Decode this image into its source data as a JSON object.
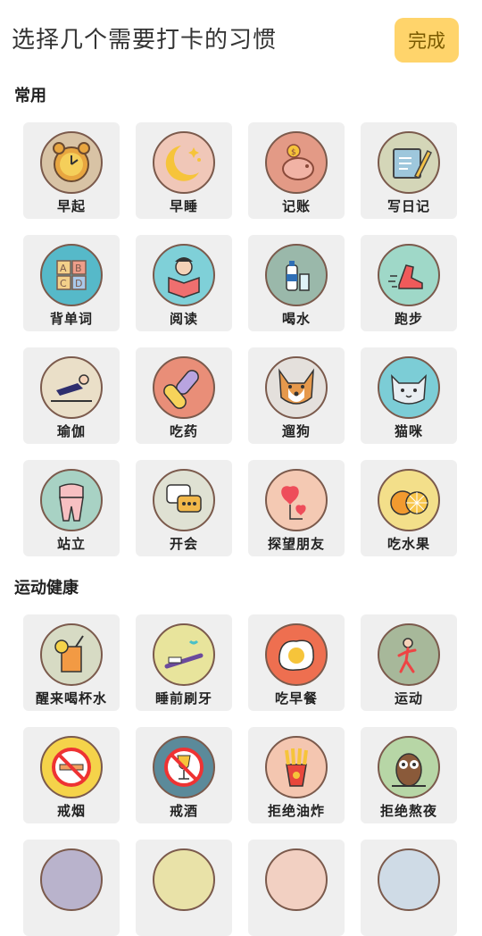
{
  "header": {
    "title": "选择几个需要打卡的习惯",
    "done_label": "完成"
  },
  "colors": {
    "accent": "#ffd46b",
    "card_bg": "#efefef",
    "ring": "#7b5a4c"
  },
  "sections": [
    {
      "title": "常用",
      "items": [
        {
          "label": "早起",
          "icon": "alarm-clock-icon"
        },
        {
          "label": "早睡",
          "icon": "moon-stars-icon"
        },
        {
          "label": "记账",
          "icon": "piggy-bank-icon"
        },
        {
          "label": "写日记",
          "icon": "diary-pencil-icon"
        },
        {
          "label": "背单词",
          "icon": "abcd-blocks-icon"
        },
        {
          "label": "阅读",
          "icon": "reading-person-icon"
        },
        {
          "label": "喝水",
          "icon": "water-bottle-icon"
        },
        {
          "label": "跑步",
          "icon": "running-shoe-icon"
        },
        {
          "label": "瑜伽",
          "icon": "yoga-pose-icon"
        },
        {
          "label": "吃药",
          "icon": "pills-icon"
        },
        {
          "label": "遛狗",
          "icon": "corgi-dog-icon"
        },
        {
          "label": "猫咪",
          "icon": "cat-face-icon"
        },
        {
          "label": "站立",
          "icon": "standing-body-icon"
        },
        {
          "label": "开会",
          "icon": "chat-bubbles-icon"
        },
        {
          "label": "探望朋友",
          "icon": "hearts-icon"
        },
        {
          "label": "吃水果",
          "icon": "orange-fruit-icon"
        }
      ]
    },
    {
      "title": "运动健康",
      "items": [
        {
          "label": "醒来喝杯水",
          "icon": "lemon-drink-icon"
        },
        {
          "label": "睡前刷牙",
          "icon": "toothbrush-icon"
        },
        {
          "label": "吃早餐",
          "icon": "fried-egg-icon"
        },
        {
          "label": "运动",
          "icon": "exercise-figure-icon"
        },
        {
          "label": "戒烟",
          "icon": "no-smoking-icon"
        },
        {
          "label": "戒酒",
          "icon": "no-alcohol-icon"
        },
        {
          "label": "拒绝油炸",
          "icon": "french-fries-icon"
        },
        {
          "label": "拒绝熬夜",
          "icon": "owl-icon"
        }
      ]
    }
  ]
}
